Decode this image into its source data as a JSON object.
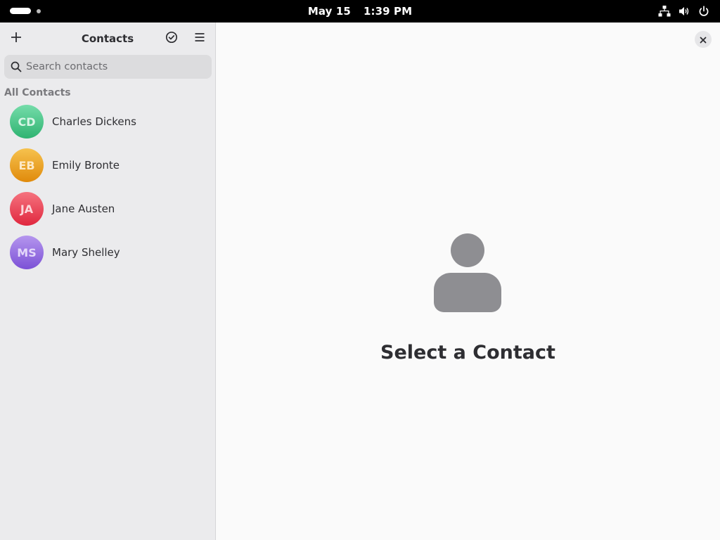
{
  "topbar": {
    "date": "May 15",
    "time": "1:39 PM",
    "icons": [
      "network-icon",
      "volume-icon",
      "power-icon"
    ]
  },
  "sidebar": {
    "title": "Contacts",
    "buttons": [
      "add-icon",
      "select-icon",
      "menu-icon"
    ],
    "search": {
      "placeholder": "Search contacts",
      "value": ""
    },
    "section_label": "All Contacts",
    "contacts": [
      {
        "initials": "CD",
        "name": "Charles Dickens",
        "color": "#3fbf7f"
      },
      {
        "initials": "EB",
        "name": "Emily Bronte",
        "color": "#f0a21e"
      },
      {
        "initials": "JA",
        "name": "Jane Austen",
        "color": "#ea3f53"
      },
      {
        "initials": "MS",
        "name": "Mary Shelley",
        "color": "#9168e0"
      }
    ]
  },
  "main": {
    "placeholder_text": "Select a Contact",
    "placeholder_icon": "person-icon",
    "close_icon": "close-icon"
  }
}
